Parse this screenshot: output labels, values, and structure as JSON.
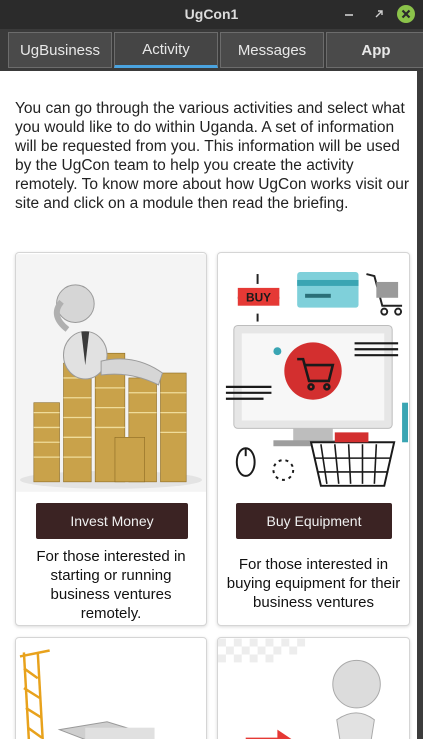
{
  "window": {
    "title": "UgCon1"
  },
  "tabs": [
    {
      "label": "UgBusiness"
    },
    {
      "label": "Activity"
    },
    {
      "label": "Messages"
    },
    {
      "label": "App"
    }
  ],
  "intro": "You can go through the various activities and select what you would like to do within Uganda. A set of information will be requested from you. This information will be used by the UgCon team to help you create the activity remotely. To know more about how UgCon works visit our site and click on a module then read the briefing.",
  "cards": [
    {
      "button": "Invest Money",
      "description": "For those interested in starting or running business ventures remotely."
    },
    {
      "button": "Buy Equipment",
      "description": "For those interested in buying equipment for their business ventures"
    }
  ],
  "illustration": {
    "buy_label": "BUY"
  }
}
